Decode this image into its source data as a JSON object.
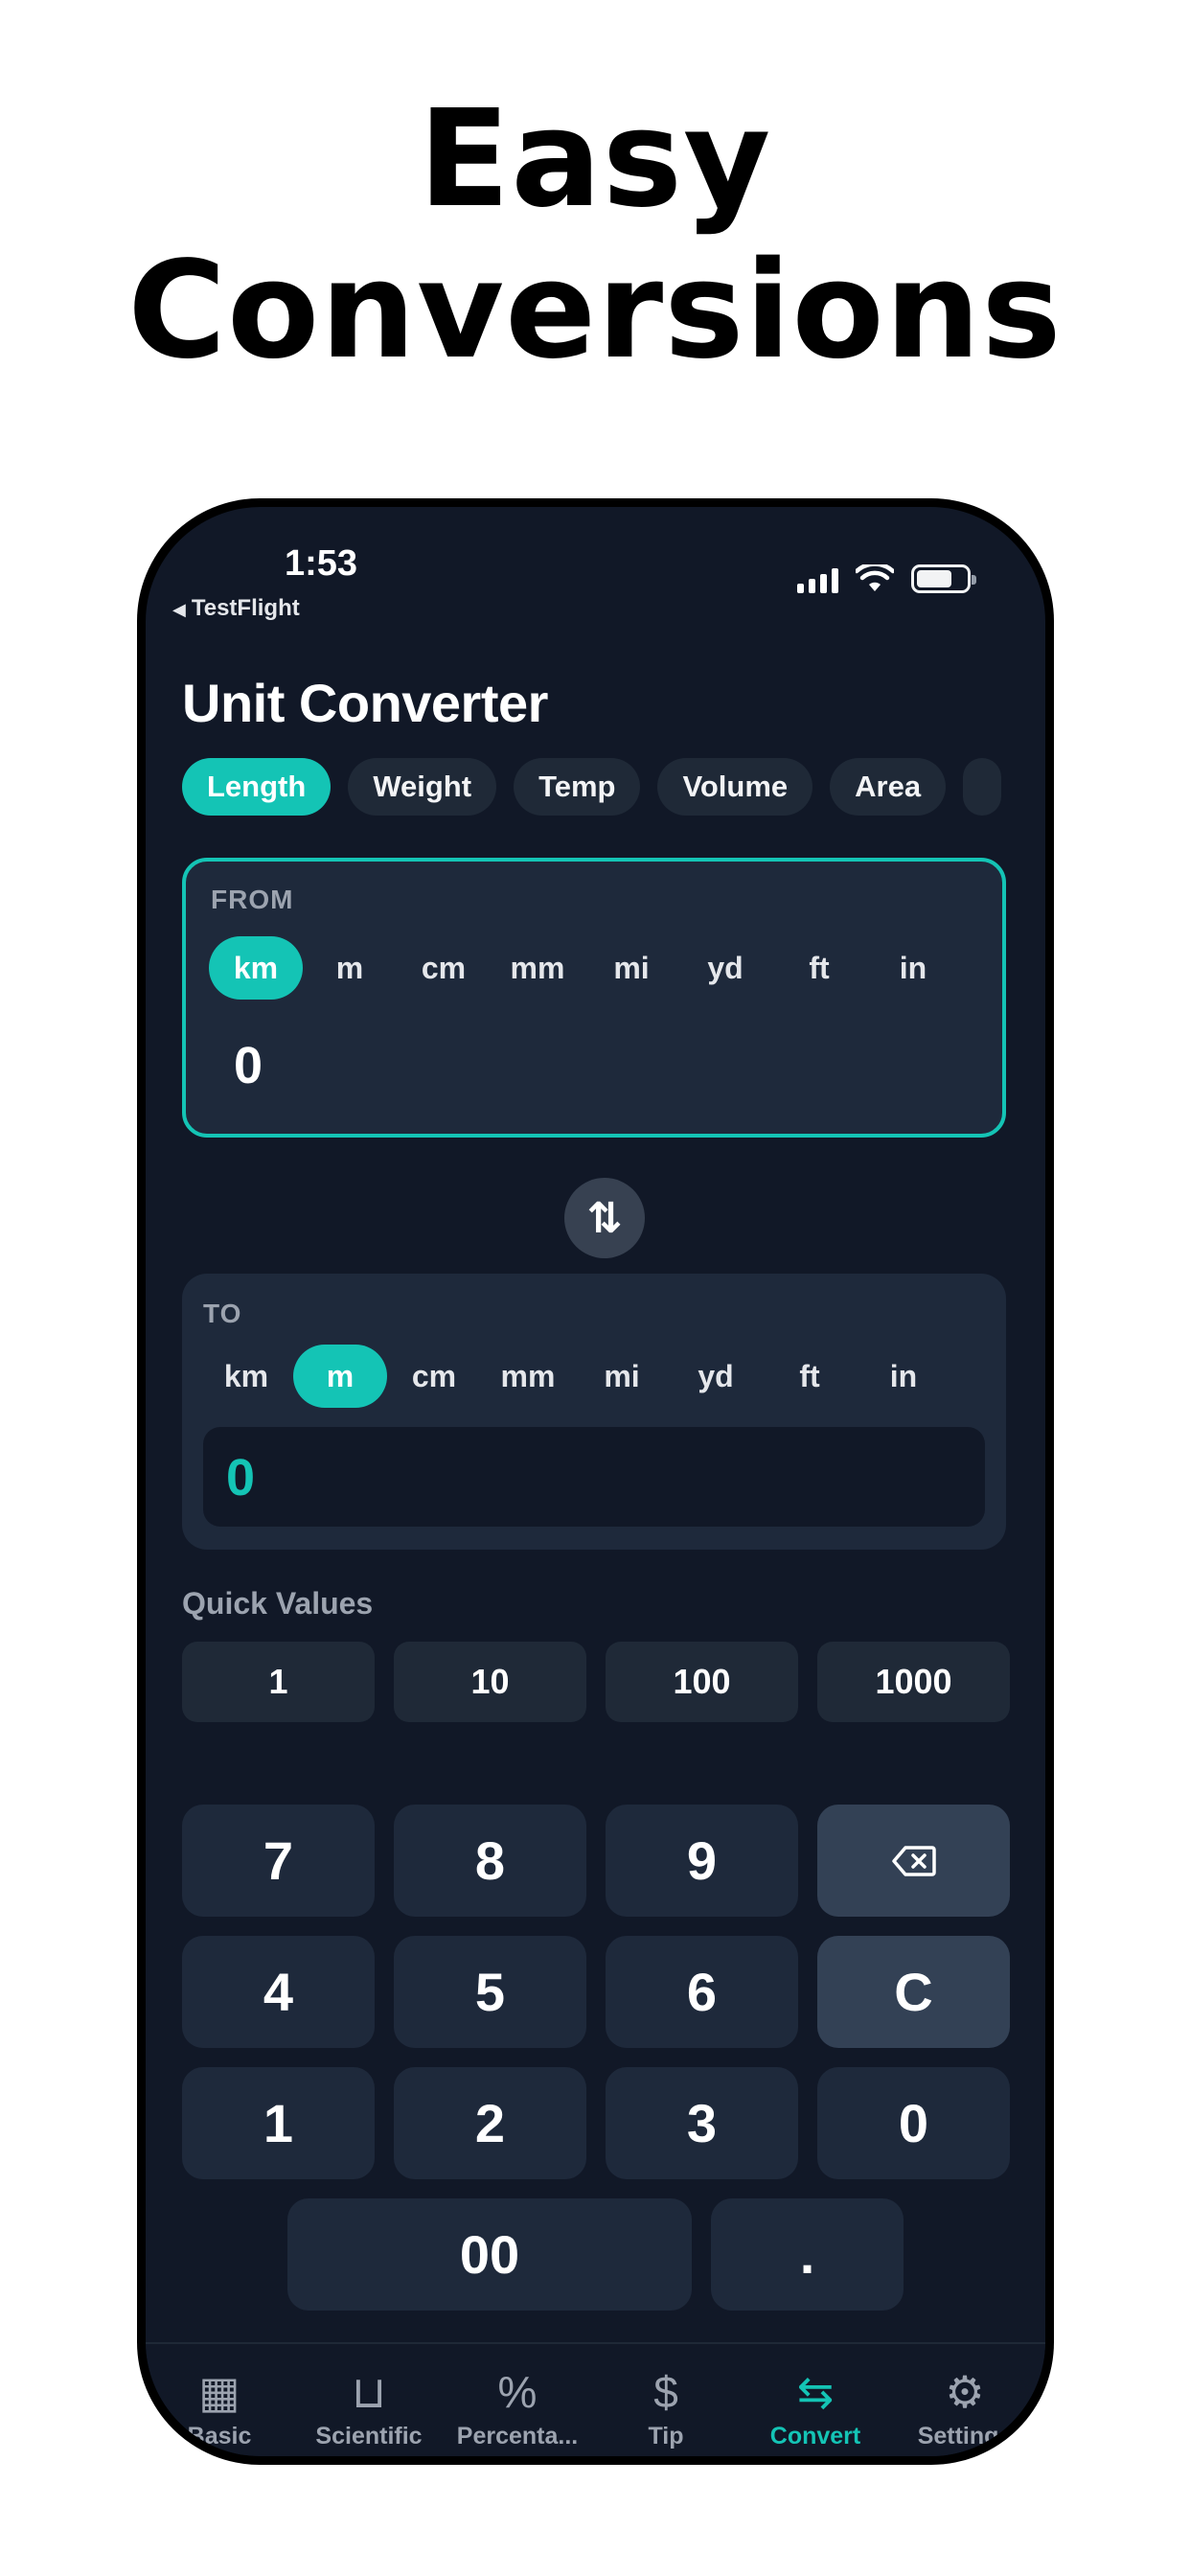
{
  "headline": {
    "line1": "Easy",
    "line2": "Conversions"
  },
  "status_bar": {
    "time": "1:53",
    "back_app": "TestFlight"
  },
  "screen": {
    "title": "Unit Converter"
  },
  "categories": [
    {
      "label": "Length",
      "active": true
    },
    {
      "label": "Weight"
    },
    {
      "label": "Temp"
    },
    {
      "label": "Volume"
    },
    {
      "label": "Area"
    },
    {
      "label": ""
    }
  ],
  "from": {
    "label": "FROM",
    "units": [
      "km",
      "m",
      "cm",
      "mm",
      "mi",
      "yd",
      "ft",
      "in"
    ],
    "selected_unit": "km",
    "value": "0"
  },
  "swap": {
    "icon": "swap-vertical-icon",
    "glyph": "⇅"
  },
  "to": {
    "label": "TO",
    "units": [
      "km",
      "m",
      "cm",
      "mm",
      "mi",
      "yd",
      "ft",
      "in"
    ],
    "selected_unit": "m",
    "value": "0"
  },
  "quick_values": {
    "label": "Quick Values",
    "values": [
      "1",
      "10",
      "100",
      "1000"
    ]
  },
  "keypad": {
    "keys": [
      "7",
      "8",
      "9",
      "⌫",
      "4",
      "5",
      "6",
      "C",
      "1",
      "2",
      "3",
      "0",
      "00",
      "."
    ]
  },
  "tabs": [
    {
      "label": "Basic",
      "icon": "calculator-icon",
      "glyph": "▦"
    },
    {
      "label": "Scientific",
      "icon": "beaker-icon",
      "glyph": "⊔"
    },
    {
      "label": "Percenta...",
      "icon": "percent-icon",
      "glyph": "%"
    },
    {
      "label": "Tip",
      "icon": "receipt-icon",
      "glyph": "$"
    },
    {
      "label": "Convert",
      "icon": "arrows-exchange-icon",
      "glyph": "⇆",
      "active": true
    },
    {
      "label": "Settings",
      "icon": "gear-icon",
      "glyph": "⚙"
    }
  ],
  "colors": {
    "accent": "#14c4b5",
    "background": "#111827",
    "card": "#1e293b"
  }
}
